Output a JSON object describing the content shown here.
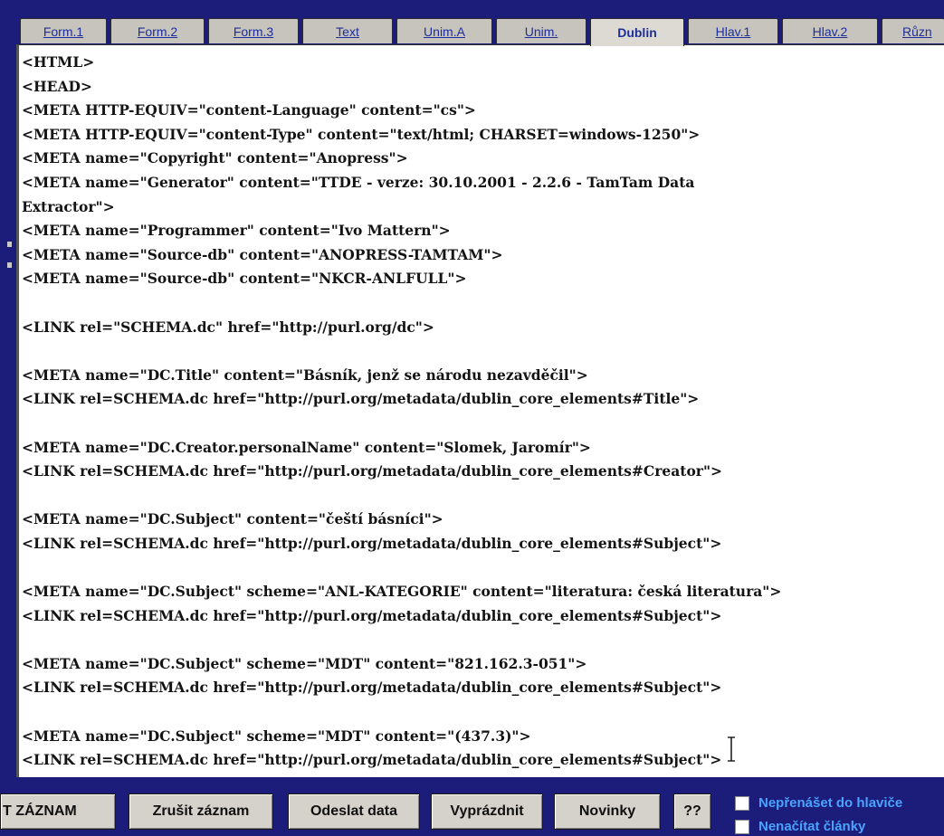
{
  "tabs": [
    {
      "label": "Form.1",
      "active": false
    },
    {
      "label": "Form.2",
      "active": false
    },
    {
      "label": "Form.3",
      "active": false
    },
    {
      "label": "Text",
      "active": false
    },
    {
      "label": "Unim.A",
      "active": false
    },
    {
      "label": "Unim.",
      "active": false
    },
    {
      "label": "Dublin",
      "active": true
    },
    {
      "label": "Hlav.1",
      "active": false
    },
    {
      "label": "Hlav.2",
      "active": false
    },
    {
      "label": "Různ",
      "active": false
    }
  ],
  "editor": {
    "lines": [
      "<HTML>",
      "<HEAD>",
      "<META HTTP-EQUIV=\"content-Language\" content=\"cs\">",
      "<META HTTP-EQUIV=\"content-Type\" content=\"text/html; CHARSET=windows-1250\">",
      "<META name=\"Copyright\" content=\"Anopress\">",
      "<META name=\"Generator\" content=\"TTDE - verze: 30.10.2001 - 2.2.6 - TamTam Data",
      "Extractor\">",
      "<META name=\"Programmer\" content=\"Ivo Mattern\">",
      "<META name=\"Source-db\" content=\"ANOPRESS-TAMTAM\">",
      "<META name=\"Source-db\" content=\"NKCR-ANLFULL\">",
      "",
      "<LINK rel=\"SCHEMA.dc\" href=\"http://purl.org/dc\">",
      "",
      "<META name=\"DC.Title\" content=\"Básník, jenž se národu nezavděčil\">",
      "<LINK rel=SCHEMA.dc href=\"http://purl.org/metadata/dublin_core_elements#Title\">",
      "",
      "<META name=\"DC.Creator.personalName\" content=\"Slomek, Jaromír\">",
      "<LINK rel=SCHEMA.dc href=\"http://purl.org/metadata/dublin_core_elements#Creator\">",
      "",
      "<META name=\"DC.Subject\" content=\"čeští básníci\">",
      "<LINK rel=SCHEMA.dc href=\"http://purl.org/metadata/dublin_core_elements#Subject\">",
      "",
      "<META name=\"DC.Subject\" scheme=\"ANL-KATEGORIE\" content=\"literatura: česká literatura\">",
      "<LINK rel=SCHEMA.dc href=\"http://purl.org/metadata/dublin_core_elements#Subject\">",
      "",
      "<META name=\"DC.Subject\" scheme=\"MDT\" content=\"821.162.3-051\">",
      "<LINK rel=SCHEMA.dc href=\"http://purl.org/metadata/dublin_core_elements#Subject\">",
      "",
      "<META name=\"DC.Subject\" scheme=\"MDT\" content=\"(437.3)\">",
      "<LINK rel=SCHEMA.dc href=\"http://purl.org/metadata/dublin_core_elements#Subject\">"
    ]
  },
  "buttons": {
    "save": "T ZÁZNAM",
    "cancel": "Zrušit záznam",
    "send": "Odeslat data",
    "clear": "Vyprázdnit",
    "news": "Novinky",
    "help": "??"
  },
  "checkboxes": [
    {
      "label": "Nepřenášet do hlaviče",
      "checked": false
    },
    {
      "label": "Nenačítat články",
      "checked": false
    }
  ],
  "colors": {
    "frame": "#1c1c7a",
    "tab_text": "#1f2f9a",
    "checkbox_text": "#4aa3ff"
  }
}
